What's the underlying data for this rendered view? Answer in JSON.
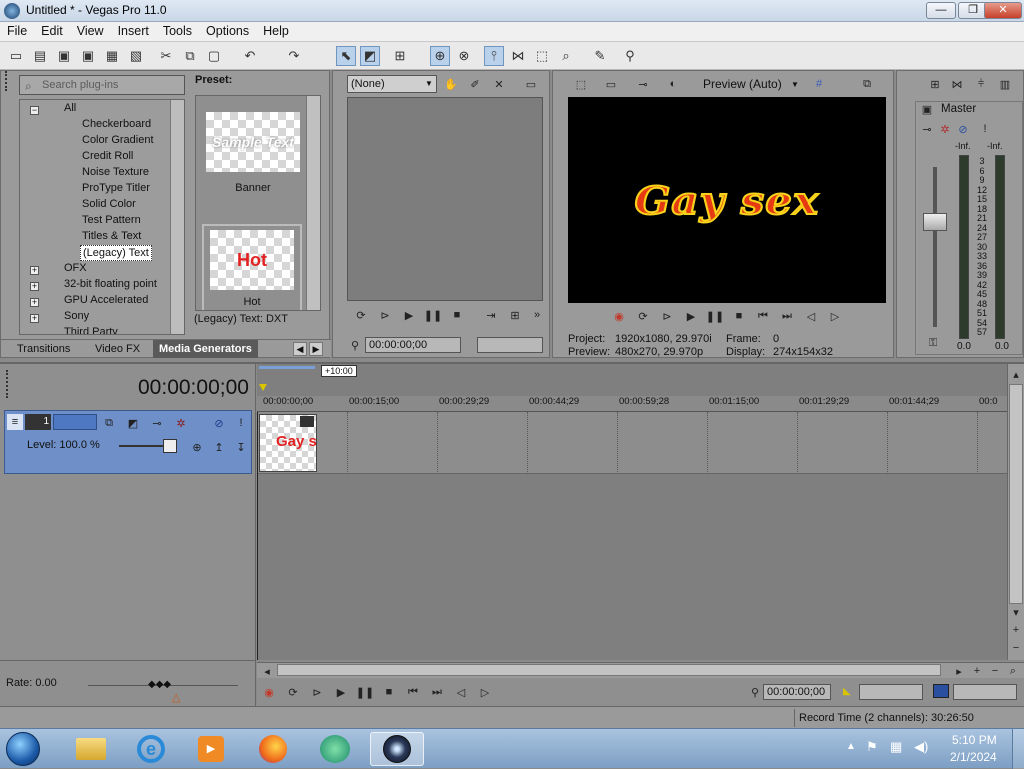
{
  "window": {
    "title": "Untitled * - Vegas Pro 11.0",
    "min": "—",
    "max": "❐",
    "close": "✕"
  },
  "menu": [
    "File",
    "Edit",
    "View",
    "Insert",
    "Tools",
    "Options",
    "Help"
  ],
  "plugins": {
    "search_placeholder": "Search plug-ins",
    "tree": [
      "All",
      "Checkerboard",
      "Color Gradient",
      "Credit Roll",
      "Noise Texture",
      "ProType Titler",
      "Solid Color",
      "Test Pattern",
      "Titles & Text",
      "(Legacy) Text",
      "OFX",
      "32-bit floating point",
      "GPU Accelerated",
      "Sony",
      "Third Party"
    ],
    "selected": "(Legacy) Text",
    "preset_label": "Preset:",
    "presets": [
      {
        "label": "Banner",
        "thumb_text": "Sample Text"
      },
      {
        "label": "Hot",
        "thumb_text": "Hot"
      }
    ],
    "status": "(Legacy) Text: DXT",
    "tabs": [
      "Transitions",
      "Video FX",
      "Media Generators"
    ]
  },
  "trimmer": {
    "dropdown": "(None)",
    "timecode": "00:00:00;00"
  },
  "preview": {
    "mode": "Preview (Auto)",
    "frame_text": "Gay sex",
    "project_label": "Project:",
    "project_value": "1920x1080, 29.970i",
    "preview_label": "Preview:",
    "preview_value": "480x270, 29.970p",
    "frame_label": "Frame:",
    "frame_value": "0",
    "display_label": "Display:",
    "display_value": "274x154x32"
  },
  "master": {
    "label": "Master",
    "inf_left": "-Inf.",
    "inf_right": "-Inf.",
    "scale": [
      "3",
      "6",
      "9",
      "12",
      "15",
      "18",
      "21",
      "24",
      "27",
      "30",
      "33",
      "36",
      "39",
      "42",
      "45",
      "48",
      "51",
      "54",
      "57"
    ],
    "val_left": "0.0",
    "val_right": "0.0"
  },
  "timeline": {
    "timecode": "00:00:00;00",
    "offset_badge": "+10:00",
    "ruler": [
      "00:00:00;00",
      "00:00:15;00",
      "00:00:29;29",
      "00:00:44;29",
      "00:00:59;28",
      "00:01:15;00",
      "00:01:29;29",
      "00:01:44;29",
      "00:0"
    ],
    "track_number": "1",
    "track_level": "Level: 100.0 %",
    "clip_text": "Gay s"
  },
  "transport": {
    "rate": "Rate: 0.00",
    "timecode": "00:00:00;00",
    "record_time": "Record Time (2 channels): 30:26:50"
  },
  "taskbar": {
    "time": "5:10 PM",
    "date": "2/1/2024"
  },
  "colors": {
    "accent": "#5b8fd6",
    "track_header": "#6e8fc7",
    "record": "#c0392b"
  }
}
